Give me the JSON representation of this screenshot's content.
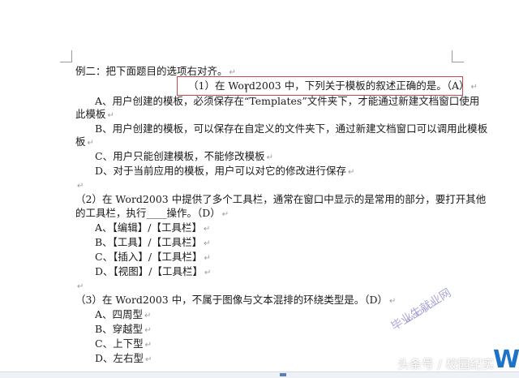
{
  "document": {
    "heading": "例二：把下面题目的选项右对齐。",
    "q1": {
      "stem": "（1）在 Word2003 中，下列关于模板的叙述正确的是。（A）",
      "options": [
        "A、用户创建的模板，必须保存在“Templates”文件夹下，才能通过新建文档窗口使用",
        "此模板",
        "B、用户创建的模板，可以保存在自定义的文件夹下，通过新建文档窗口可以调用此模板",
        "板",
        "C、用户只能创建模板，不能修改模板",
        "D、对于当前应用的模板，用户可以对它的修改进行保存"
      ]
    },
    "q2": {
      "stem_line1": "（2）在 Word2003 中提供了多个工具栏，通常在窗口中显示的是常用的部分，要打开其他",
      "stem_line2": "的工具栏，执行____操作。（D）",
      "options": [
        "A、【编辑】/【工具栏】",
        "B、【工具】/【工具栏】",
        "C、【插入】/【工具栏】",
        "D、【视图】/【工具栏】"
      ]
    },
    "q3": {
      "stem": "（3）在 Word2003 中，不属于图像与文本混排的环绕类型是。（D）",
      "options": [
        "A、四周型",
        "B、穿越型",
        "C、上下型",
        "D、左右型"
      ]
    },
    "paragraph_mark": "↵",
    "cursor_glyph": "I"
  },
  "watermark": {
    "text": "毕业生就业网",
    "sub": "www.by.cn"
  },
  "attribution": "头条号 / 校园纪实",
  "logo_fragment": "WC",
  "colors": {
    "highlight_border": "#c9484d",
    "logo": "#1d73c8"
  }
}
